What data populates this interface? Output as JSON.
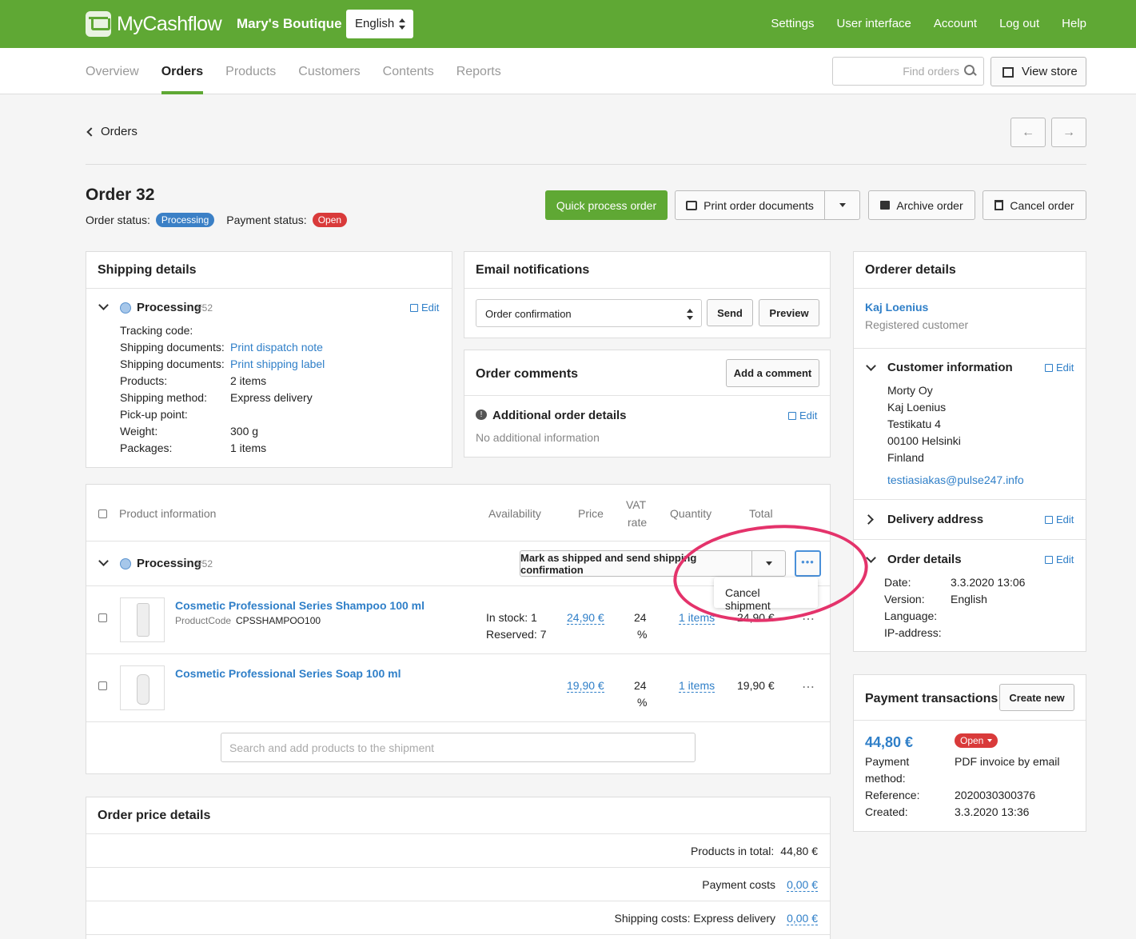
{
  "app": {
    "name": "MyCashflow",
    "shop_name": "Mary's Boutique",
    "language": "English"
  },
  "topnav": [
    "Settings",
    "User interface",
    "Account",
    "Log out",
    "Help"
  ],
  "tabs": [
    "Overview",
    "Orders",
    "Products",
    "Customers",
    "Contents",
    "Reports"
  ],
  "search": {
    "placeholder": "Find orders"
  },
  "view_store": "View store",
  "back": "Orders",
  "order": {
    "title": "Order 32",
    "status_label": "Order status:",
    "status": "Processing",
    "payment_label": "Payment status:",
    "payment_status": "Open"
  },
  "actions": {
    "quick": "Quick process order",
    "print": "Print order documents",
    "archive": "Archive order",
    "cancel": "Cancel order"
  },
  "shipping": {
    "title": "Shipping details",
    "state": "Processing",
    "id": "#52",
    "edit": "Edit",
    "tracking_label": "Tracking code:",
    "docs_label": "Shipping documents:",
    "dispatch": "Print dispatch note",
    "label": "Print shipping label",
    "products_label": "Products:",
    "products": "2 items",
    "method_label": "Shipping method:",
    "method": "Express delivery",
    "pickup_label": "Pick-up point:",
    "weight_label": "Weight:",
    "weight": "300 g",
    "packages_label": "Packages:",
    "packages": "1 items"
  },
  "email": {
    "title": "Email notifications",
    "selected": "Order confirmation",
    "send": "Send",
    "preview": "Preview"
  },
  "comments": {
    "title": "Order comments",
    "add": "Add a comment",
    "additional_title": "Additional order details",
    "edit": "Edit",
    "none": "No additional information"
  },
  "table": {
    "headers": {
      "product": "Product information",
      "availability": "Availability",
      "price": "Price",
      "vat1": "VAT",
      "vat2": "rate",
      "quantity": "Quantity",
      "total": "Total"
    },
    "shipment_state": "Processing",
    "shipment_id": "#52",
    "mark_shipped": "Mark as shipped and send shipping confirmation",
    "popup": "Cancel shipment",
    "rows": [
      {
        "name": "Cosmetic Professional Series Shampoo 100 ml",
        "code_label": "ProductCode",
        "code": "CPSSHAMPOO100",
        "stock": "In stock: 1",
        "reserved": "Reserved: 7",
        "price": "24,90 €",
        "vat1": "24",
        "vat2": "%",
        "qty": "1 items",
        "total": "24,90 €"
      },
      {
        "name": "Cosmetic Professional Series Soap 100 ml",
        "price": "19,90 €",
        "vat1": "24",
        "vat2": "%",
        "qty": "1 items",
        "total": "19,90 €"
      }
    ],
    "search_placeholder": "Search and add products to the shipment"
  },
  "price_details": {
    "title": "Order price details",
    "products_label": "Products in total:",
    "products_value": "44,80 €",
    "payment_label": "Payment costs",
    "payment_value": "0,00 €",
    "shipping_label": "Shipping costs: Express delivery",
    "shipping_value": "0,00 €"
  },
  "orderer": {
    "title": "Orderer details",
    "name": "Kaj Loenius",
    "type": "Registered customer",
    "customer_info_title": "Customer information",
    "edit": "Edit",
    "address": [
      "Morty Oy",
      "Kaj Loenius",
      "Testikatu 4",
      "00100 Helsinki",
      "Finland"
    ],
    "email": "testiasiakas@pulse247.info",
    "delivery_title": "Delivery address",
    "details_title": "Order details",
    "date_label": "Date:",
    "date": "3.3.2020 13:06",
    "version_label": "Version:",
    "version": "English",
    "language_label": "Language:",
    "ip_label": "IP-address:"
  },
  "payment": {
    "title": "Payment transactions",
    "create": "Create new",
    "amount": "44,80 €",
    "status": "Open",
    "method_label1": "Payment",
    "method_label2": "method:",
    "method": "PDF invoice by email",
    "reference_label": "Reference:",
    "reference": "2020030300376",
    "created_label": "Created:",
    "created": "3.3.2020 13:36"
  },
  "colors": {
    "brand": "#5fa834",
    "link": "#2f7fc8",
    "processing": "#3b80c6",
    "open": "#d93a3a",
    "annotation": "#e4336b"
  }
}
